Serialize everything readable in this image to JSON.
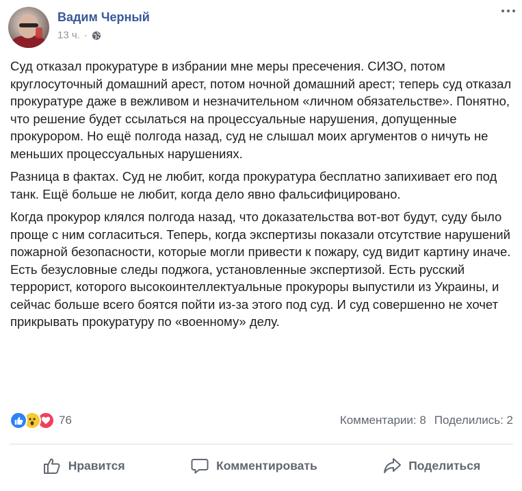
{
  "post": {
    "author": "Вадим Черный",
    "time": "13 ч.",
    "separator": "·",
    "paragraphs": [
      "Суд отказал прокуратуре в избрании мне меры пресечения. СИЗО, потом круглосуточный домашний арест, потом ночной домашний арест; теперь суд отказал прокуратуре даже в вежливом и незначительном «личном обязательстве». Понятно, что решение будет ссылаться на процессуальные нарушения, допущенные прокурором. Но ещё полгода назад, суд не слышал моих аргументов о ничуть не меньших процессуальных нарушениях.",
      "Разница в фактах. Суд не любит, когда прокуратура бесплатно запихивает его под танк. Ещё больше не любит, когда дело явно фальсифицировано.",
      "Когда прокурор клялся полгода назад, что доказательства вот-вот будут, суду было проще с ним согласиться. Теперь, когда экспертизы показали отсутствие нарушений пожарной безопасности, которые могли привести к пожару, суд видит картину иначе. Есть безусловные следы поджога, установленные экспертизой. Есть русский террорист, которого высокоинтеллектуальные прокуроры выпустили из Украины, и сейчас больше всего боятся пойти из-за этого под суд. И суд совершенно не хочет прикрывать прокуратуру по «военному» делу."
    ],
    "reactions": {
      "count": "76",
      "types": [
        "like",
        "wow",
        "love"
      ]
    },
    "comments_label": "Комментарии: 8",
    "shares_label": "Поделились: 2"
  },
  "actions": {
    "like_label": "Нравится",
    "comment_label": "Комментировать",
    "share_label": "Поделиться"
  },
  "icons": {
    "avatar": "profile-photo",
    "privacy": "globe-icon",
    "menu": "more-icon",
    "like": "thumbs-up-icon",
    "comment": "comment-bubble-icon",
    "share": "share-arrow-icon"
  },
  "colors": {
    "author_name": "#385898",
    "muted_text": "#606770",
    "meta_text": "#90949c",
    "like_reaction": "#2f81f7",
    "wow_reaction": "#f7c933",
    "love_reaction": "#f0405b"
  }
}
